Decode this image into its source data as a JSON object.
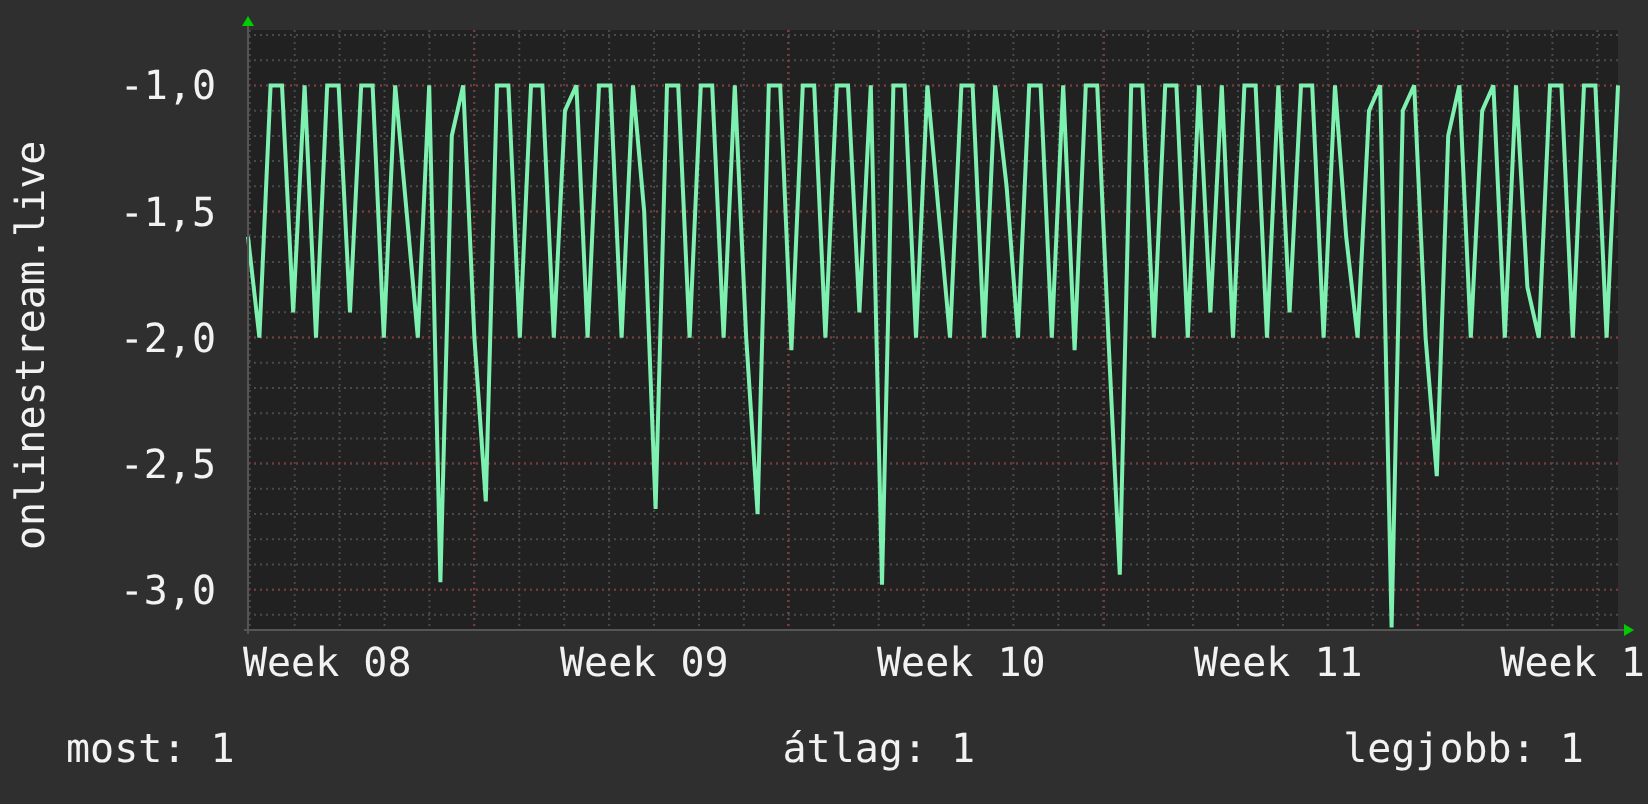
{
  "chart": {
    "chart_data": {
      "type": "line",
      "ylabel": "onlinestream.live",
      "categories": [
        null,
        null,
        null,
        null,
        null,
        null,
        null,
        "Week 08",
        null,
        null,
        null,
        null,
        null,
        null,
        null,
        null,
        null,
        null,
        null,
        null,
        null,
        null,
        null,
        null,
        null,
        null,
        null,
        null,
        null,
        null,
        null,
        null,
        null,
        null,
        null,
        "Week 09",
        null,
        null,
        null,
        null,
        null,
        null,
        null,
        null,
        null,
        null,
        null,
        null,
        null,
        null,
        null,
        null,
        null,
        null,
        null,
        null,
        null,
        null,
        null,
        null,
        null,
        null,
        null,
        "Week 10",
        null,
        null,
        null,
        null,
        null,
        null,
        null,
        null,
        null,
        null,
        null,
        null,
        null,
        null,
        null,
        null,
        null,
        null,
        null,
        null,
        null,
        null,
        null,
        null,
        null,
        null,
        null,
        "Week 11",
        null,
        null,
        null,
        null,
        null,
        null,
        null,
        null,
        null,
        null,
        null,
        null,
        null,
        null,
        null,
        null,
        null,
        null,
        null,
        null,
        null,
        null,
        null,
        null,
        null,
        "Week 1",
        null,
        null,
        null,
        null
      ],
      "grid": true,
      "series": [
        {
          "color": "#7ef0b0",
          "values": [
            -1.6,
            -2,
            -1,
            -1,
            -1.9,
            -1,
            -2,
            -1,
            -1,
            -1.9,
            -1,
            -1,
            -2,
            -1,
            -1.5,
            -2,
            -1,
            -2.97,
            -1.2,
            -1,
            -2,
            -2.65,
            -1,
            -1,
            -2,
            -1,
            -1,
            -2,
            -1.1,
            -1,
            -2,
            -1,
            -1,
            -2,
            -1,
            -1.5,
            -2.68,
            -1,
            -1,
            -2,
            -1,
            -1,
            -2,
            -1,
            -2,
            -2.7,
            -1,
            -1,
            -2.05,
            -1,
            -1,
            -2,
            -1,
            -1,
            -1.9,
            -1,
            -2.98,
            -1,
            -1,
            -2,
            -1,
            -1.5,
            -2,
            -1,
            -1,
            -2,
            -1,
            -1.4,
            -2,
            -1,
            -1,
            -2,
            -1,
            -2.05,
            -1,
            -1,
            -2,
            -2.94,
            -1,
            -1,
            -2,
            -1,
            -1,
            -2,
            -1,
            -1.9,
            -1,
            -2,
            -1,
            -1,
            -2,
            -1,
            -1.9,
            -1,
            -1,
            -2,
            -1,
            -1.6,
            -2,
            -1.1,
            -1,
            -3.15,
            -1.1,
            -1,
            -2,
            -2.55,
            -1.2,
            -1,
            -2,
            -1.1,
            -1,
            -2,
            -1,
            -1.8,
            -2,
            -1,
            -1,
            -2,
            -1,
            -1,
            -2,
            -1
          ]
        }
      ],
      "ylim": [
        -3.16,
        -0.78
      ],
      "yticks": [
        {
          "value": -1,
          "label": "-1,0"
        },
        {
          "value": -1.5,
          "label": "-1,5"
        },
        {
          "value": -2,
          "label": "-2,0"
        },
        {
          "value": -2.5,
          "label": "-2,5"
        },
        {
          "value": -3,
          "label": "-3,0"
        }
      ]
    }
  },
  "legend": [
    {
      "label": "most:",
      "value": "1"
    },
    {
      "label": "átlag:",
      "value": "1"
    },
    {
      "label": "legjobb:",
      "value": "1"
    }
  ]
}
